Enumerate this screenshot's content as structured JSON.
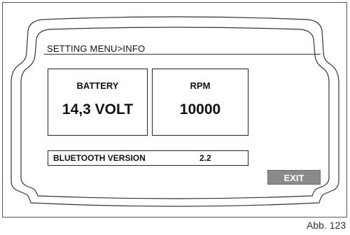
{
  "menu": {
    "breadcrumb": "SETTING MENU>INFO"
  },
  "battery": {
    "label": "BATTERY",
    "value": "14,3 VOLT"
  },
  "rpm": {
    "label": "RPM",
    "value": "10000"
  },
  "bluetooth": {
    "label": "BLUETOOTH VERSION",
    "value": "2.2"
  },
  "actions": {
    "exit_label": "EXIT"
  },
  "figure": {
    "caption": "Abb. 123"
  },
  "colors": {
    "exit_button_bg": "#8a8a8a",
    "exit_button_text": "#ffffff",
    "outline": "#222222"
  }
}
